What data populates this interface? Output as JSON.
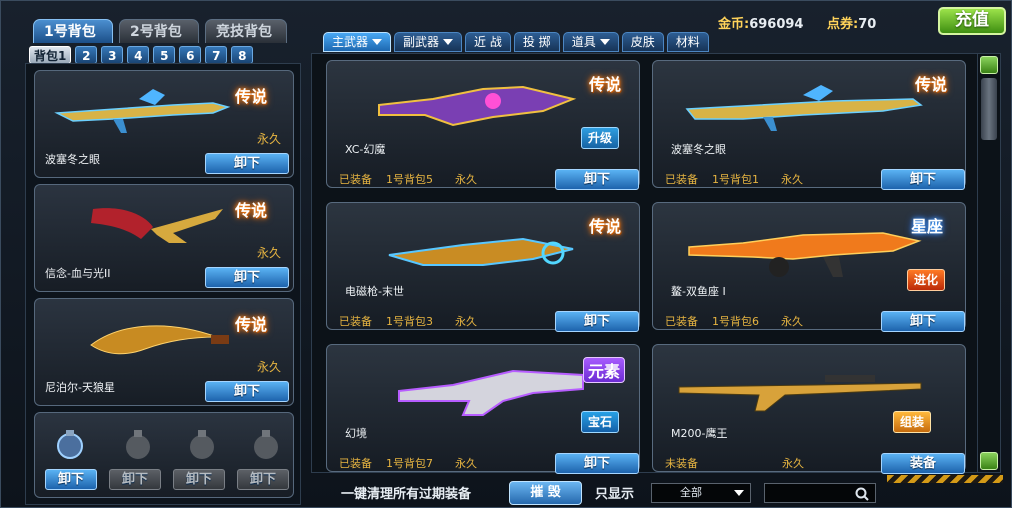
{
  "bags": [
    "1号背包",
    "2号背包",
    "竞技背包"
  ],
  "subtabs": [
    "背包1",
    "2",
    "3",
    "4",
    "5",
    "6",
    "7",
    "8"
  ],
  "currency": {
    "gold_label": "金币:",
    "gold_value": "696094",
    "points_label": "点券:",
    "points_value": "70",
    "recharge": "充值"
  },
  "categories": [
    "主武器",
    "副武器",
    "近 战",
    "投 掷",
    "道具",
    "皮肤",
    "材料"
  ],
  "left_slots": [
    {
      "name": "波塞冬之眼",
      "badge": "传说",
      "duration": "永久",
      "button": "卸下"
    },
    {
      "name": "信念-血与光II",
      "badge": "传说",
      "duration": "永久",
      "button": "卸下"
    },
    {
      "name": "尼泊尔-天狼星",
      "badge": "传说",
      "duration": "永久",
      "button": "卸下"
    }
  ],
  "throw_slots": [
    "卸下",
    "卸下",
    "卸下",
    "卸下"
  ],
  "items": [
    {
      "name": "XC-幻魔",
      "badge": "传说",
      "action": "升级",
      "status": "已装备",
      "bag": "1号背包5",
      "duration": "永久",
      "button": "卸下"
    },
    {
      "name": "波塞冬之眼",
      "badge": "传说",
      "status": "已装备",
      "bag": "1号背包1",
      "duration": "永久",
      "button": "卸下"
    },
    {
      "name": "电磁枪-末世",
      "badge": "传说",
      "status": "已装备",
      "bag": "1号背包3",
      "duration": "永久",
      "button": "卸下"
    },
    {
      "name": "鳌-双鱼座 I",
      "badge": "星座",
      "action": "进化",
      "status": "已装备",
      "bag": "1号背包6",
      "duration": "永久",
      "button": "卸下"
    },
    {
      "name": "幻境",
      "badge": "元素",
      "action": "宝石",
      "status": "已装备",
      "bag": "1号背包7",
      "duration": "永久",
      "button": "卸下"
    },
    {
      "name": "M200-鹰王",
      "action": "组装",
      "status": "未装备",
      "duration": "永久",
      "button": "装备"
    }
  ],
  "bottom": {
    "clear_label": "一键清理所有过期装备",
    "destroy": "摧 毁",
    "filter_label": "只显示",
    "filter_value": "全部"
  },
  "colors": {
    "accent_blue": "#1d63ac",
    "gold_text": "#e6b441",
    "recharge_green": "#3f8f11"
  }
}
